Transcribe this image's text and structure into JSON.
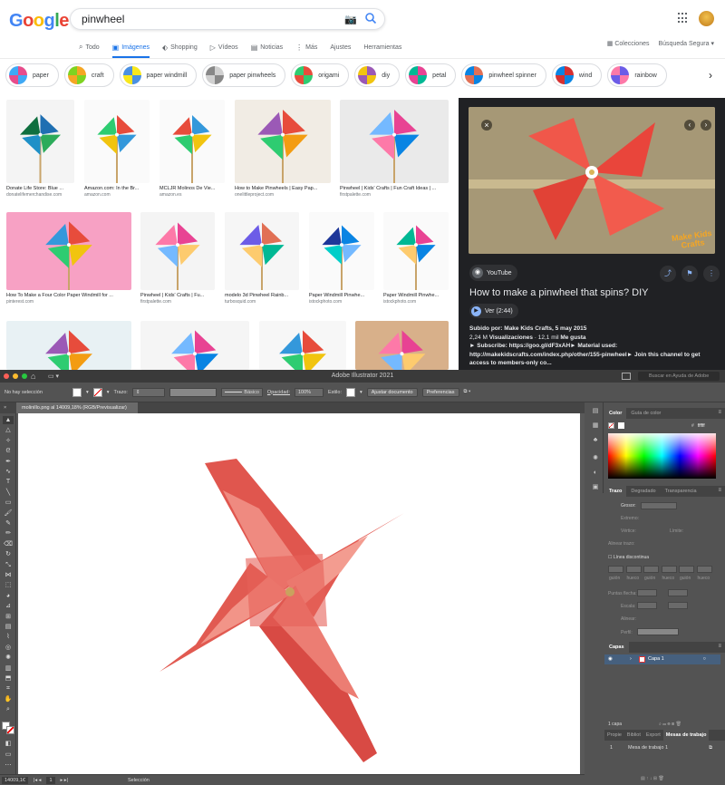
{
  "google": {
    "logo": "Google",
    "search_value": "pinwheel",
    "tabs": [
      {
        "label": "Todo",
        "icon": "search-icon",
        "glyph": "⌕"
      },
      {
        "label": "Imágenes",
        "icon": "images-icon",
        "glyph": "▣"
      },
      {
        "label": "Shopping",
        "icon": "tag-icon",
        "glyph": "⬖"
      },
      {
        "label": "Vídeos",
        "icon": "play-icon",
        "glyph": "▷"
      },
      {
        "label": "Noticias",
        "icon": "news-icon",
        "glyph": "▤"
      },
      {
        "label": "Más",
        "icon": "more-icon",
        "glyph": "⋮"
      },
      {
        "label": "Ajustes",
        "icon": "",
        "glyph": ""
      },
      {
        "label": "Herramientas",
        "icon": "",
        "glyph": ""
      }
    ],
    "right_tabs": {
      "collections": "Colecciones",
      "safe_search": "Búsqueda Segura ▾"
    },
    "chips": [
      "paper",
      "craft",
      "paper windmill",
      "paper pinwheels",
      "origami",
      "diy",
      "petal",
      "pinwheel spinner",
      "wind",
      "rainbow"
    ],
    "results": [
      {
        "caption": "Donate Life Store: Blue ...",
        "source": "donatelifemerchandise.com"
      },
      {
        "caption": "Amazon.com: In the Br...",
        "source": "amazon.com"
      },
      {
        "caption": "MCLJR Molinos De Vie...",
        "source": "amazon.es"
      },
      {
        "caption": "How to Make Pinwheels | Easy Pap...",
        "source": "onelittleproject.com"
      },
      {
        "caption": "Pinwheel | Kids' Crafts | Fun Craft Ideas | ...",
        "source": "firstpalette.com"
      },
      {
        "caption": "How To Make a Four Color Paper Windmill for ...",
        "source": "pinterest.com"
      },
      {
        "caption": "Pinwheel | Kids' Crafts | Fu...",
        "source": "firstpalette.com"
      },
      {
        "caption": "modelo 3d Pinwheel Rainb...",
        "source": "turbosquid.com"
      },
      {
        "caption": "Paper Windmill Pinwhe...",
        "source": "istockphoto.com"
      },
      {
        "caption": "Paper Windmill Pinwhe...",
        "source": "istockphoto.com"
      }
    ],
    "preview": {
      "brand": "Make Kids Crafts",
      "channel": "YouTube",
      "title": "How to make a pinwheel that spins? DIY",
      "watch": "Ver (2:44)",
      "uploaded_label": "Subido por:",
      "uploaded_value": "Make Kids Crafts, 5 may 2015",
      "views": "2,24 M",
      "views_label": "Visualizaciones",
      "likes": "12,1 mil",
      "likes_label": "Me gusta",
      "desc": "► Subscribe: https://goo.gl/dF3xAH► Material used: http://makekidscrafts.com/index.php/other/155-pinwheel► Join this channel to get access to members-only co..."
    }
  },
  "ai": {
    "app_title": "Adobe Illustrator 2021",
    "help_placeholder": "Buscar en Ayuda de Adobe",
    "doc_tab": "molinillo.png al 14009,18% (RGB/Previsualizar)",
    "ctrl": {
      "selection": "No hay selección",
      "stroke": "Trazo:",
      "brush": "Básico",
      "opacity_label": "Opacidad:",
      "opacity_value": "100%",
      "style": "Estilo:",
      "doc_settings": "Ajustar documento",
      "prefs": "Preferencias"
    },
    "status": {
      "zoom": "14009,1€",
      "page": "1",
      "tool": "Selección"
    },
    "color_panel": {
      "tab1": "Color",
      "tab2": "Guía de color",
      "hex_label": "#",
      "hex_value": "ffffff"
    },
    "stroke_panel": {
      "tab1": "Trazo",
      "tab2": "Degradado",
      "tab3": "Transparencia",
      "weight": "Grosor:",
      "cap": "Extremo:",
      "corner": "Vértice:",
      "limit": "Límite:",
      "align": "Alinear trazo:",
      "dashed": "Línea discontinua",
      "dash_labels": [
        "guión",
        "hueco",
        "guión",
        "hueco",
        "guión",
        "hueco"
      ],
      "arrows": "Puntas flecha:",
      "scale": "Escala:",
      "align2": "Alinear:",
      "profile": "Perfil:"
    },
    "layers_panel": {
      "tab": "Capas",
      "layer_name": "Capa 1",
      "count": "1 capa"
    },
    "artboards_panel": {
      "tabs": [
        "Propie",
        "Bibliot",
        "Export",
        "Mesas de trabajo"
      ],
      "index": "1",
      "name": "Mesa de trabajo 1"
    }
  }
}
